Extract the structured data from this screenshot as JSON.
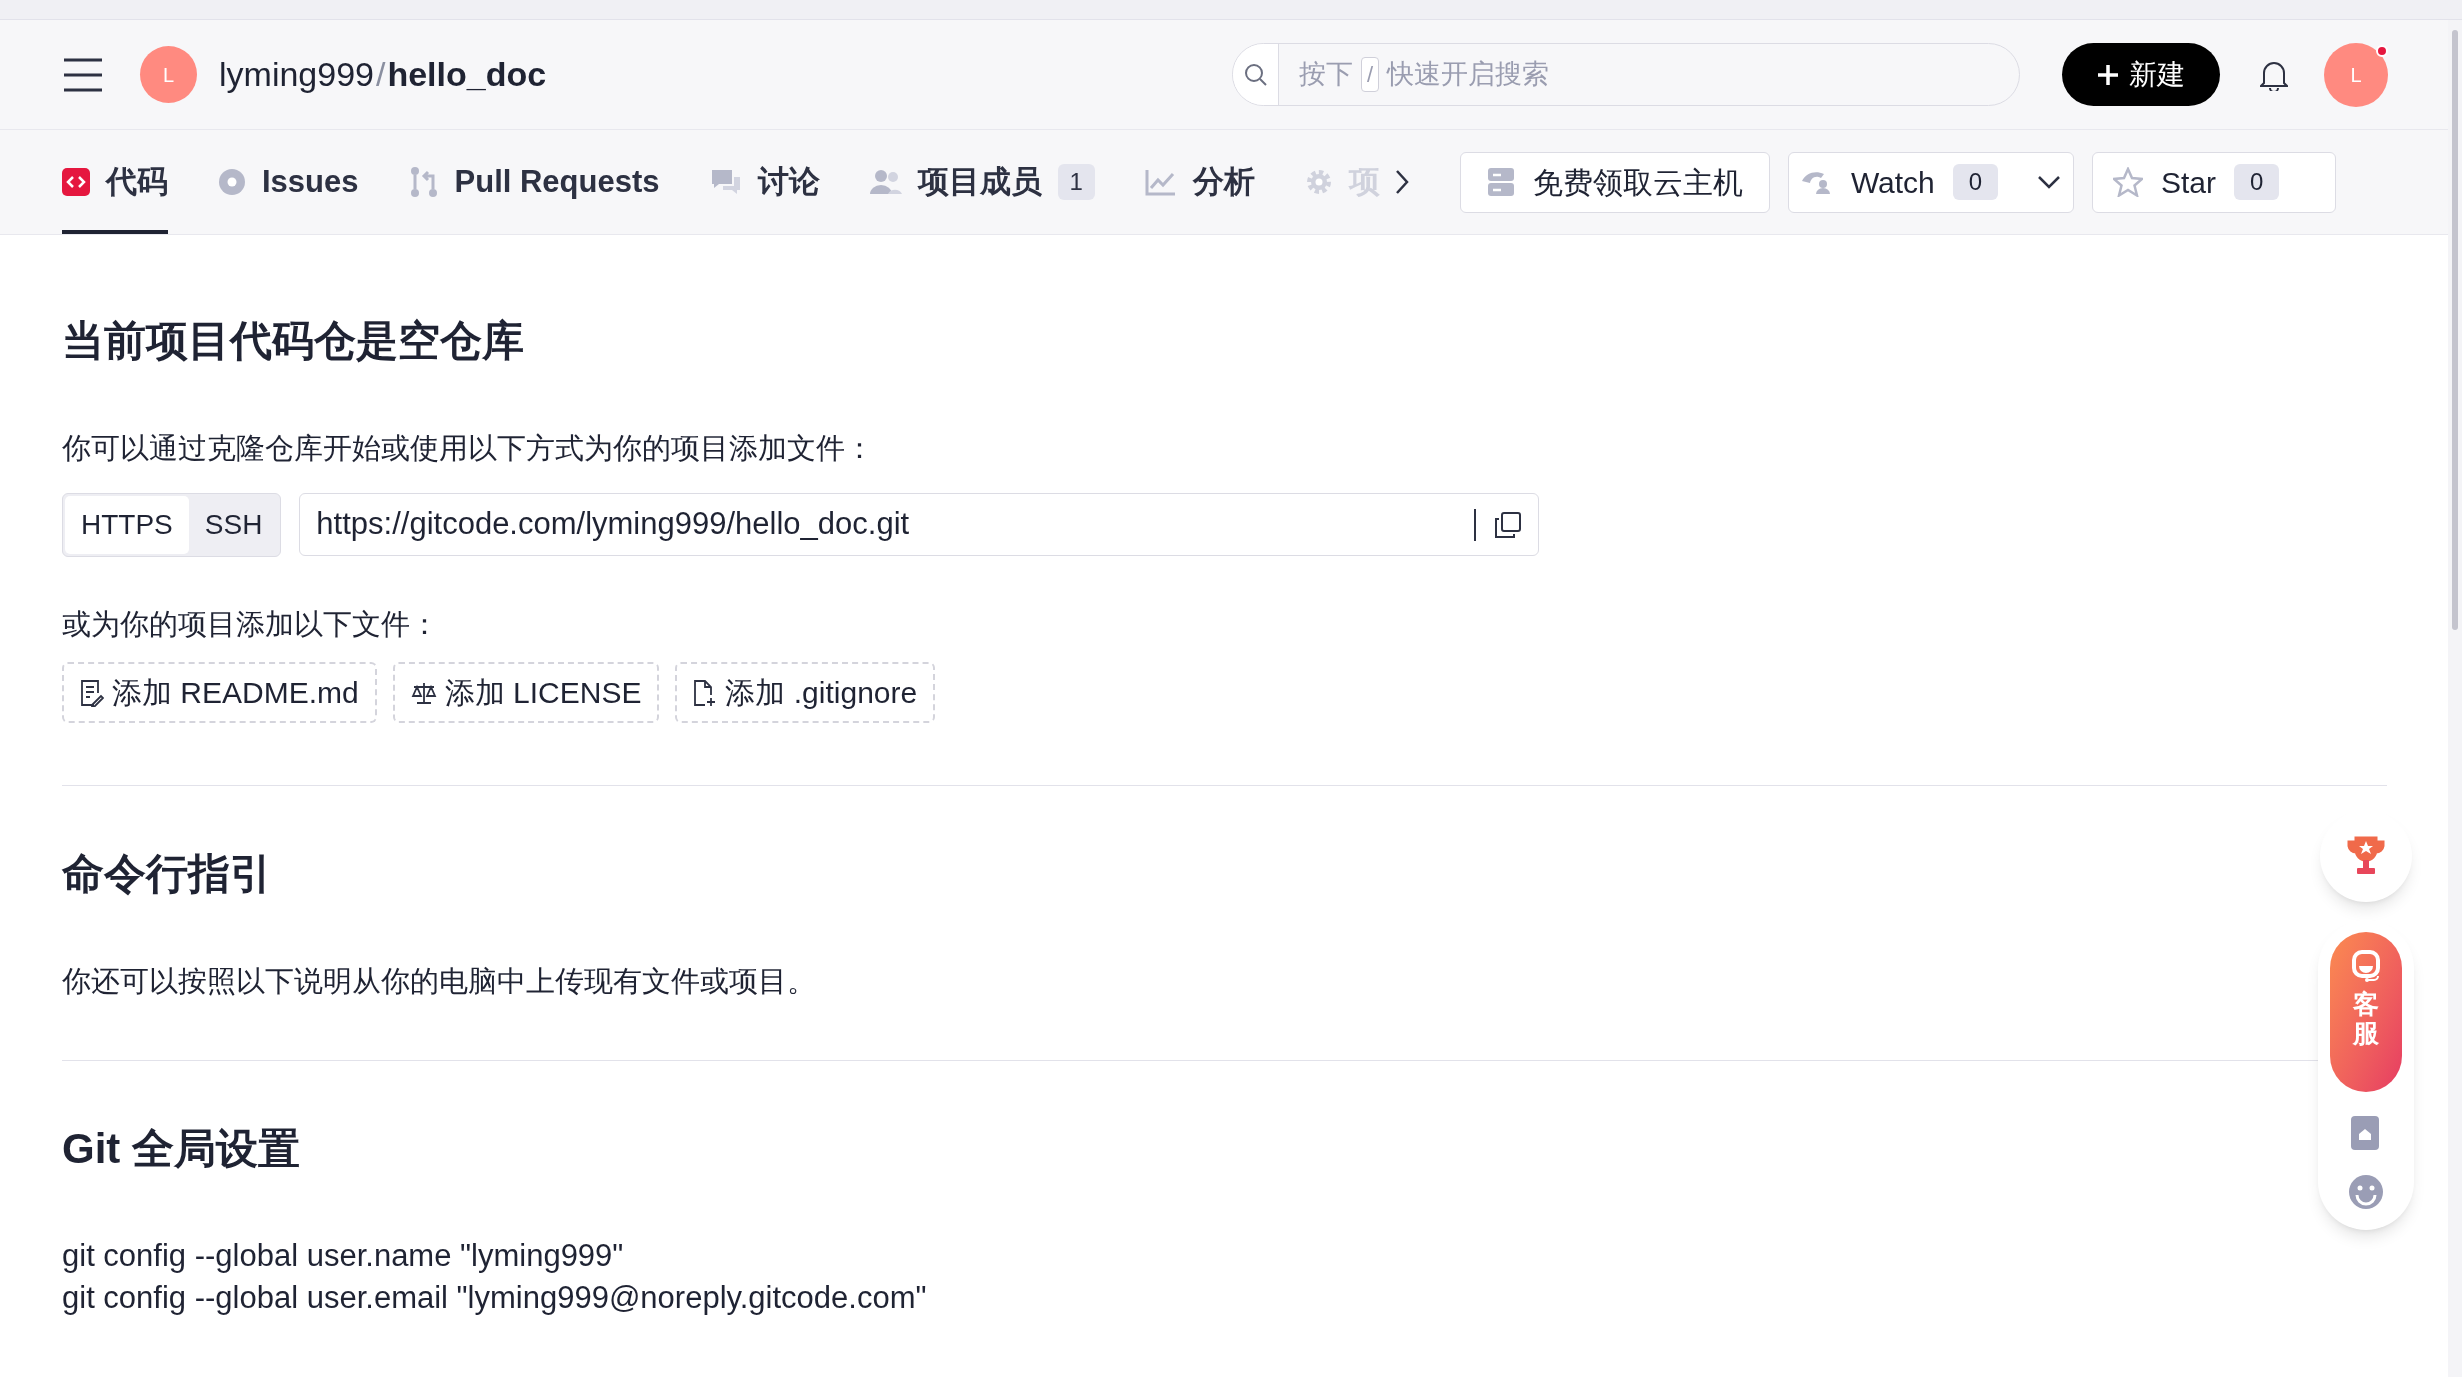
{
  "header": {
    "avatar_letter": "L",
    "owner": "lyming999",
    "separator": "/",
    "repo": "hello_doc",
    "search": {
      "prefix": "按下",
      "key": "/",
      "placeholder": "快速开启搜索"
    },
    "new_button": "新建",
    "user_avatar_letter": "L",
    "notification_dot": true
  },
  "tabs": [
    {
      "label": "代码",
      "kind": "code",
      "selected": true
    },
    {
      "label": "Issues",
      "kind": "issue",
      "selected": false
    },
    {
      "label": "Pull Requests",
      "kind": "pr",
      "selected": false
    },
    {
      "label": "讨论",
      "kind": "chat",
      "selected": false
    },
    {
      "label": "项目成员",
      "kind": "people",
      "count": "1",
      "selected": false
    },
    {
      "label": "分析",
      "kind": "chart",
      "selected": false
    },
    {
      "label": "项",
      "kind": "gear",
      "selected": false,
      "faded": true
    }
  ],
  "actions": [
    {
      "kind": "cloud",
      "label": "免费领取云主机"
    },
    {
      "kind": "watch",
      "label": "Watch",
      "count": "0"
    },
    {
      "kind": "star",
      "label": "Star",
      "count": "0"
    }
  ],
  "empty_repo": {
    "title": "当前项目代码仓是空仓库",
    "intro": "你可以通过克隆仓库开始或使用以下方式为你的项目添加文件：",
    "protocols": [
      {
        "label": "HTTPS",
        "selected": true
      },
      {
        "label": "SSH",
        "selected": false
      }
    ],
    "clone_url": "https://gitcode.com/lyming999/hello_doc.git",
    "add_intro": "或为你的项目添加以下文件：",
    "add_buttons": [
      {
        "kind": "readme",
        "label": "添加 README.md"
      },
      {
        "kind": "license",
        "label": "添加 LICENSE"
      },
      {
        "kind": "gitignore",
        "label": "添加 .gitignore"
      }
    ]
  },
  "cli": {
    "title": "命令行指引",
    "text": "你还可以按照以下说明从你的电脑中上传现有文件或项目。"
  },
  "git_setup": {
    "title": "Git 全局设置",
    "lines": [
      "git config --global user.name \"lyming999\"",
      "git config --global user.email \"lyming999@noreply.gitcode.com\""
    ]
  },
  "float_widget": {
    "service_label": "客服"
  }
}
